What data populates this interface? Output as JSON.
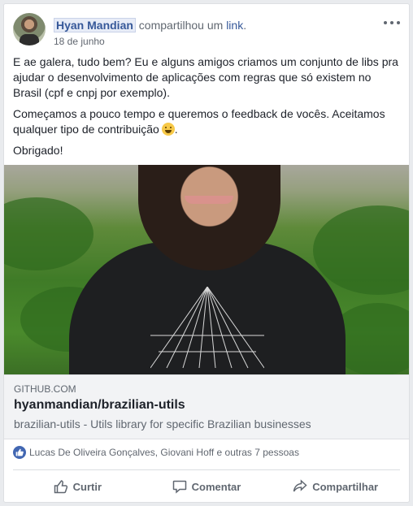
{
  "post": {
    "author": "Hyan Mandian",
    "action_text": "compartilhou um",
    "action_link": "link",
    "action_suffix": ".",
    "date": "18 de junho",
    "paragraphs": [
      "E ae galera, tudo bem? Eu e alguns amigos criamos um conjunto de libs pra ajudar o desenvolvimento de aplicações com regras que só existem no Brasil (cpf e cnpj por exemplo).",
      "Começamos a pouco tempo e queremos o feedback de vocês. Aceitamos qualquer tipo de contribuição",
      "Obrigado!"
    ],
    "paragraph2_suffix": "."
  },
  "link_preview": {
    "domain": "GITHUB.COM",
    "title": "hyanmandian/brazilian-utils",
    "description": "brazilian-utils - Utils library for specific Brazilian businesses"
  },
  "reactions": {
    "text": "Lucas De Oliveira Gonçalves, Giovani Hoff e outras 7 pessoas"
  },
  "actions": {
    "like": "Curtir",
    "comment": "Comentar",
    "share": "Compartilhar"
  },
  "colors": {
    "link_blue": "#365899",
    "like_badge": "#4267b2",
    "muted": "#606770"
  }
}
